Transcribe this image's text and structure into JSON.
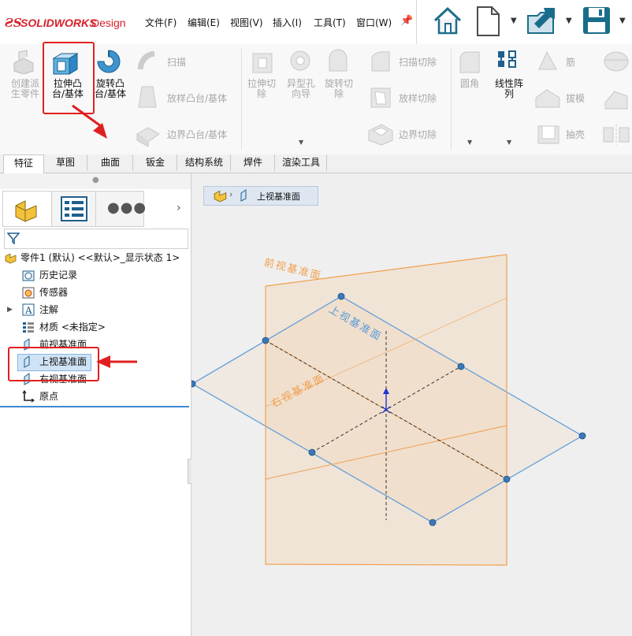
{
  "app": {
    "logo_ds": "𝟹S",
    "logo_name": "SOLIDWORKS",
    "logo_suffix": "Design"
  },
  "menu": [
    {
      "label": "文件(F)"
    },
    {
      "label": "编辑(E)"
    },
    {
      "label": "视图(V)"
    },
    {
      "label": "插入(I)"
    },
    {
      "label": "工具(T)"
    },
    {
      "label": "窗口(W)"
    }
  ],
  "ribbon": {
    "create_derived": "创建派\n生零件",
    "extrude_boss": "拉伸凸\n台/基体",
    "revolve_boss": "旋转凸\n台/基体",
    "sweep": "扫描",
    "loft_boss": "放样凸台/基体",
    "boundary_boss": "边界凸台/基体",
    "extrude_cut": "拉伸切\n除",
    "hole_wizard": "异型孔\n向导",
    "revolve_cut": "旋转切\n除",
    "swept_cut": "扫描切除",
    "lofted_cut": "放样切除",
    "boundary_cut": "边界切除",
    "fillet": "圆角",
    "linear_pattern": "线性阵\n列",
    "rib": "筋",
    "draft": "拔模",
    "shell": "抽壳"
  },
  "tabs": [
    {
      "label": "特征",
      "active": true
    },
    {
      "label": "草图"
    },
    {
      "label": "曲面"
    },
    {
      "label": "钣金"
    },
    {
      "label": "结构系统"
    },
    {
      "label": "焊件"
    },
    {
      "label": "渲染工具"
    }
  ],
  "tree": {
    "part": "零件1 (默认) <<默认>_显示状态 1>",
    "items": [
      {
        "label": "历史记录",
        "icon": "history-icon"
      },
      {
        "label": "传感器",
        "icon": "sensor-icon"
      },
      {
        "label": "注解",
        "icon": "annotation-icon"
      },
      {
        "label": "材质 <未指定>",
        "icon": "material-icon"
      },
      {
        "label": "前视基准面",
        "icon": "plane-icon"
      },
      {
        "label": "上视基准面",
        "icon": "plane-icon",
        "selected": true
      },
      {
        "label": "右视基准面",
        "icon": "plane-icon"
      },
      {
        "label": "原点",
        "icon": "origin-icon"
      }
    ]
  },
  "breadcrumb": {
    "label": "上视基准面"
  },
  "viewport": {
    "front_plane_label": "前视基准面",
    "top_plane_label": "上视基准面",
    "right_plane_label": "右视基准面"
  },
  "colors": {
    "accent_red": "#e02020",
    "plane_orange": "#f4a460",
    "plane_blue": "#5a9ad8",
    "brand_red": "#d8202a"
  }
}
